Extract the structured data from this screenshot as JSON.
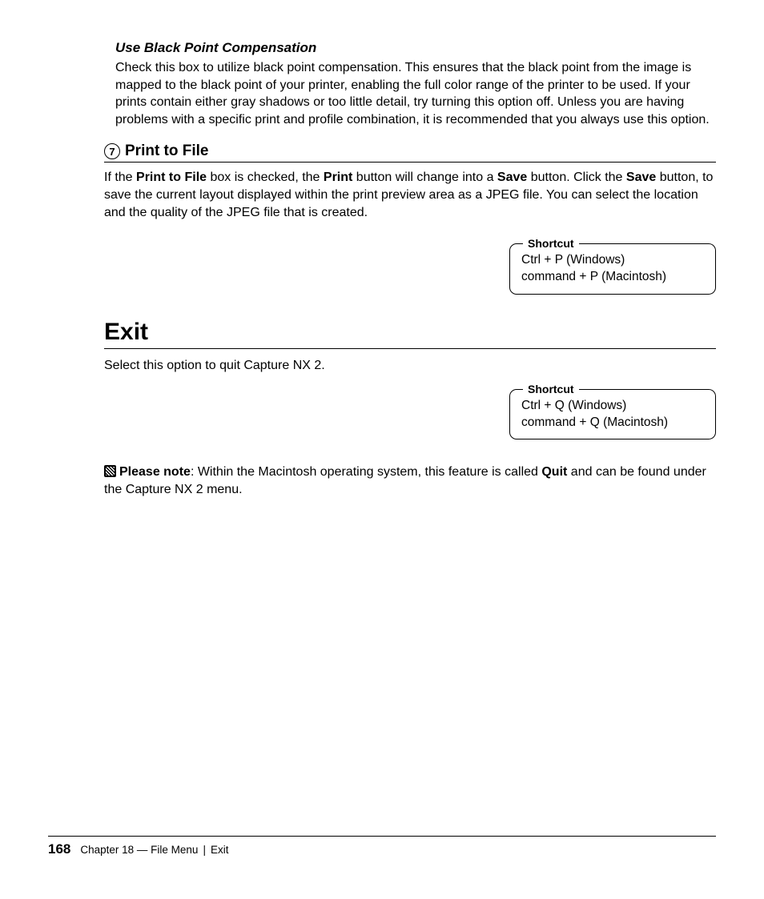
{
  "section_bpc": {
    "heading": "Use Black Point Compensation",
    "body": "Check this box to utilize black point compensation. This ensures that the black point from the image is mapped to the black point of your printer, enabling the full color range of the printer to be used. If your prints contain either gray shadows or too little detail, try turning this option off. Unless you are having problems with a specific print and profile combination, it is recommended that you always use this option."
  },
  "section_ptf": {
    "number": "7",
    "heading": "Print to File",
    "para_pre": "If the ",
    "bold1": "Print to File",
    "para_mid1": " box is checked, the ",
    "bold2": "Print",
    "para_mid2": " button will change into a ",
    "bold3": "Save",
    "para_mid3": " button. Click the ",
    "bold4": "Save",
    "para_post": " button, to save the current layout displayed within the print preview area as a JPEG file. You can select the location and the quality of the JPEG file that is created."
  },
  "shortcut1": {
    "legend": "Shortcut",
    "line1": "Ctrl + P (Windows)",
    "line2": "command + P (Macintosh)"
  },
  "section_exit": {
    "heading": "Exit",
    "body": "Select this option to quit Capture NX 2."
  },
  "shortcut2": {
    "legend": "Shortcut",
    "line1": "Ctrl + Q (Windows)",
    "line2": "command + Q (Macintosh)"
  },
  "note": {
    "bold_lead": "Please note",
    "pre": ": Within the Macintosh operating system, this feature is called ",
    "bold_word": "Quit",
    "post": " and can be found under the Capture NX 2 menu."
  },
  "footer": {
    "page": "168",
    "chapter": "Chapter 18 — File Menu",
    "sep": "|",
    "title": "Exit"
  }
}
